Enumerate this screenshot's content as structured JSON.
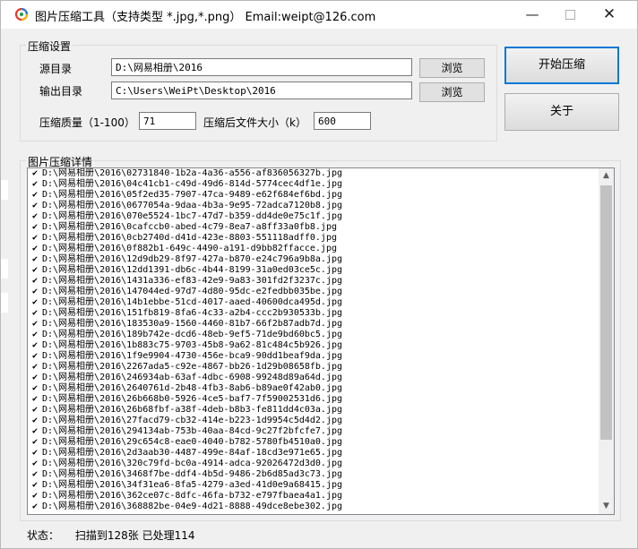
{
  "window": {
    "title": "图片压缩工具（支持类型 *.jpg,*.png）   Email:weipt@126.com",
    "minimize": "—",
    "close": "✕"
  },
  "compress": {
    "group_title": "压缩设置",
    "source_label": "源目录",
    "source_value": "D:\\网易相册\\2016",
    "output_label": "输出目录",
    "output_value": "C:\\Users\\WeiPt\\Desktop\\2016",
    "browse_label": "浏览",
    "quality_label": "压缩质量（1-100）",
    "quality_value": "71",
    "size_label": "压缩后文件大小（k）",
    "size_value": "600"
  },
  "actions": {
    "start_label": "开始压缩",
    "about_label": "关于"
  },
  "details": {
    "group_title": "图片压缩详情",
    "files": [
      "D:\\网易相册\\2016\\02731840-1b2a-4a36-a556-af836056327b.jpg",
      "D:\\网易相册\\2016\\04c41cb1-c49d-49d6-814d-5774cec4df1e.jpg",
      "D:\\网易相册\\2016\\05f2ed35-7907-47ca-9489-e62f684ef6bd.jpg",
      "D:\\网易相册\\2016\\0677054a-9daa-4b3a-9e95-72adca7120b8.jpg",
      "D:\\网易相册\\2016\\070e5524-1bc7-47d7-b359-dd4de0e75c1f.jpg",
      "D:\\网易相册\\2016\\0cafccb0-abed-4c79-8ea7-a8ff33a0fb8.jpg",
      "D:\\网易相册\\2016\\0cb2740d-d41d-423e-8803-551118adff0.jpg",
      "D:\\网易相册\\2016\\0f882b1-649c-4490-a191-d9bb82ffacce.jpg",
      "D:\\网易相册\\2016\\12d9db29-8f97-427a-b870-e24c796a9b8a.jpg",
      "D:\\网易相册\\2016\\12dd1391-db6c-4b44-8199-31a0ed03ce5c.jpg",
      "D:\\网易相册\\2016\\1431a336-ef83-42e9-9a83-301fd2f3237c.jpg",
      "D:\\网易相册\\2016\\147044ed-97d7-4d80-95dc-e2fedbb035be.jpg",
      "D:\\网易相册\\2016\\14b1ebbe-51cd-4017-aaed-40600dca495d.jpg",
      "D:\\网易相册\\2016\\151fb819-8fa6-4c33-a2b4-ccc2b930533b.jpg",
      "D:\\网易相册\\2016\\183530a9-1560-4460-81b7-66f2b87adb7d.jpg",
      "D:\\网易相册\\2016\\189b742e-dcd6-48eb-9ef5-71de9bd60bc5.jpg",
      "D:\\网易相册\\2016\\1b883c75-9703-45b8-9a62-81c484c5b926.jpg",
      "D:\\网易相册\\2016\\1f9e9904-4730-456e-bca9-90dd1beaf9da.jpg",
      "D:\\网易相册\\2016\\2267ada5-c92e-4867-bb26-1d29b08658fb.jpg",
      "D:\\网易相册\\2016\\246934ab-63af-4dbc-6908-99248d89a64d.jpg",
      "D:\\网易相册\\2016\\2640761d-2b48-4fb3-8ab6-b89ae0f42ab0.jpg",
      "D:\\网易相册\\2016\\26b668b0-5926-4ce5-baf7-7f59002531d6.jpg",
      "D:\\网易相册\\2016\\26b68fbf-a38f-4deb-b8b3-fe811dd4c03a.jpg",
      "D:\\网易相册\\2016\\27facd79-cb32-414e-b223-1d9954c5d4d2.jpg",
      "D:\\网易相册\\2016\\294134ab-753b-40aa-84cd-9c27f2bfcfe7.jpg",
      "D:\\网易相册\\2016\\29c654c8-eae0-4040-b782-5780fb4510a0.jpg",
      "D:\\网易相册\\2016\\2d3aab30-4487-499e-84af-18cd3e971e65.jpg",
      "D:\\网易相册\\2016\\320c79fd-bc0a-4914-adca-92026472d3d0.jpg",
      "D:\\网易相册\\2016\\3468f7be-ddf4-4b5d-9486-2b6d85ad3c73.jpg",
      "D:\\网易相册\\2016\\34f31ea6-8fa5-4279-a3ed-41d0e9a68415.jpg",
      "D:\\网易相册\\2016\\362ce07c-8dfc-46fa-b732-e797fbaea4a1.jpg",
      "D:\\网易相册\\2016\\368882be-04e9-4d21-8888-49dce8ebe302.jpg"
    ]
  },
  "status": {
    "label": "状态：",
    "text": "扫描到128张 已处理114"
  }
}
